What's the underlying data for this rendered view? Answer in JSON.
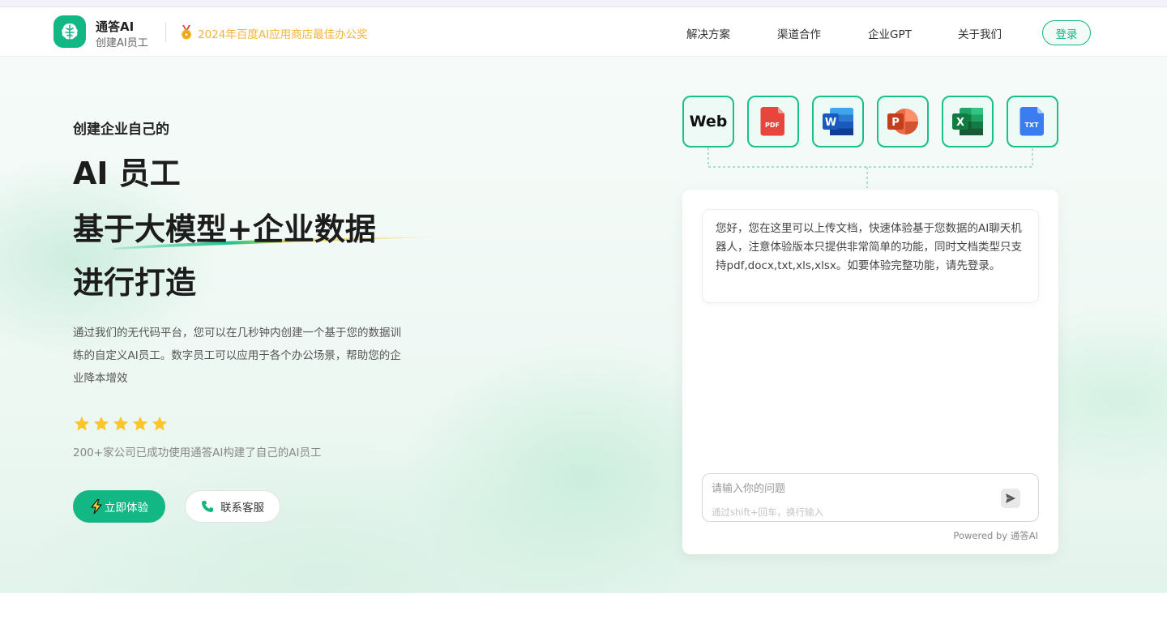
{
  "nav": {
    "brand_name": "通答AI",
    "brand_sub": "创建AI员工",
    "award": "2024年百度AI应用商店最佳办公奖",
    "links": [
      "解决方案",
      "渠道合作",
      "企业GPT",
      "关于我们"
    ],
    "login": "登录"
  },
  "hero": {
    "eyebrow": "创建企业自己的",
    "headline": [
      "AI 员工",
      "基于大模型+企业数据",
      "进行打造"
    ],
    "description": "通过我们的无代码平台，您可以在几秒钟内创建一个基于您的数据训练的自定义AI员工。数字员工可以应用于各个办公场景，帮助您的企业降本增效",
    "rating": 5,
    "rating_text": "200+家公司已成功使用通答AI构建了自己的AI员工",
    "primary_button": "立即体验",
    "secondary_button": "联系客服"
  },
  "filetypes": {
    "web": "Web",
    "pdf": "PDF",
    "word": "W",
    "ppt": "P",
    "excel": "X",
    "txt": "TXT"
  },
  "chat": {
    "greeting": "您好，您在这里可以上传文档，快速体验基于您数据的AI聊天机器人，注意体验版本只提供非常简单的功能，同时文档类型只支持pdf,docx,txt,xls,xlsx。如要体验完整功能，请先登录。",
    "input_placeholder": "请输入你的问题",
    "input_hint": "通过shift+回车，换行输入",
    "powered_by": "Powered by 通答AI"
  },
  "colors": {
    "brand": "#13b784",
    "award": "#f2b53a",
    "star": "#fcc52a"
  },
  "icons": {
    "logo": "brain-icon",
    "award": "medal-icon",
    "primary_button": "lightning-icon",
    "secondary_button": "phone-icon",
    "send": "send-icon"
  }
}
